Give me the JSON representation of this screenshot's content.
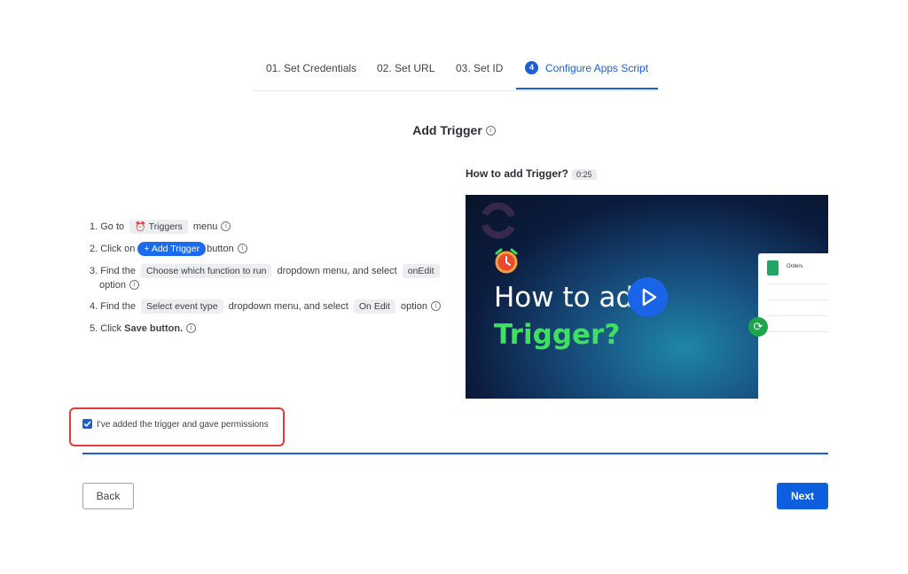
{
  "tabs": [
    {
      "label": "01. Set Credentials",
      "active": false
    },
    {
      "label": "02. Set URL",
      "active": false
    },
    {
      "label": "03. Set ID",
      "active": false
    },
    {
      "number": "4",
      "label": "Configure Apps Script",
      "active": true
    }
  ],
  "page": {
    "title": "Add Trigger"
  },
  "steps": {
    "s1": {
      "pre": "1. Go to",
      "chip": "Triggers",
      "post": "menu"
    },
    "s2": {
      "pre": "2. Click on",
      "chip": "+ Add Trigger",
      "post": "button"
    },
    "s3": {
      "pre": "3. Find the",
      "chip": "Choose which function to run",
      "mid": "dropdown menu, and select",
      "chip2": "onEdit",
      "post": "option"
    },
    "s4": {
      "pre": "4. Find the",
      "chip": "Select event type",
      "mid": "dropdown menu, and select",
      "chip2": "On Edit",
      "post": "option"
    },
    "s5": {
      "pre": "5. Click",
      "bold": "Save button."
    }
  },
  "video": {
    "label": "How to add Trigger?",
    "duration": "0:25",
    "heading_line1": "How to add",
    "heading_line2": "Trigger?",
    "sheet_label": "Orders"
  },
  "checkbox": {
    "label": "I've added the trigger and gave permissions",
    "checked": true
  },
  "buttons": {
    "back": "Back",
    "next": "Next"
  },
  "colors": {
    "accent": "#1a5fd6",
    "highlight": "#e53b3b",
    "video_green": "#3de05f"
  },
  "icons": [
    "info-icon",
    "alarm-clock-icon",
    "play-icon",
    "sync-icon",
    "google-sheets-icon",
    "checkmark-icon"
  ]
}
